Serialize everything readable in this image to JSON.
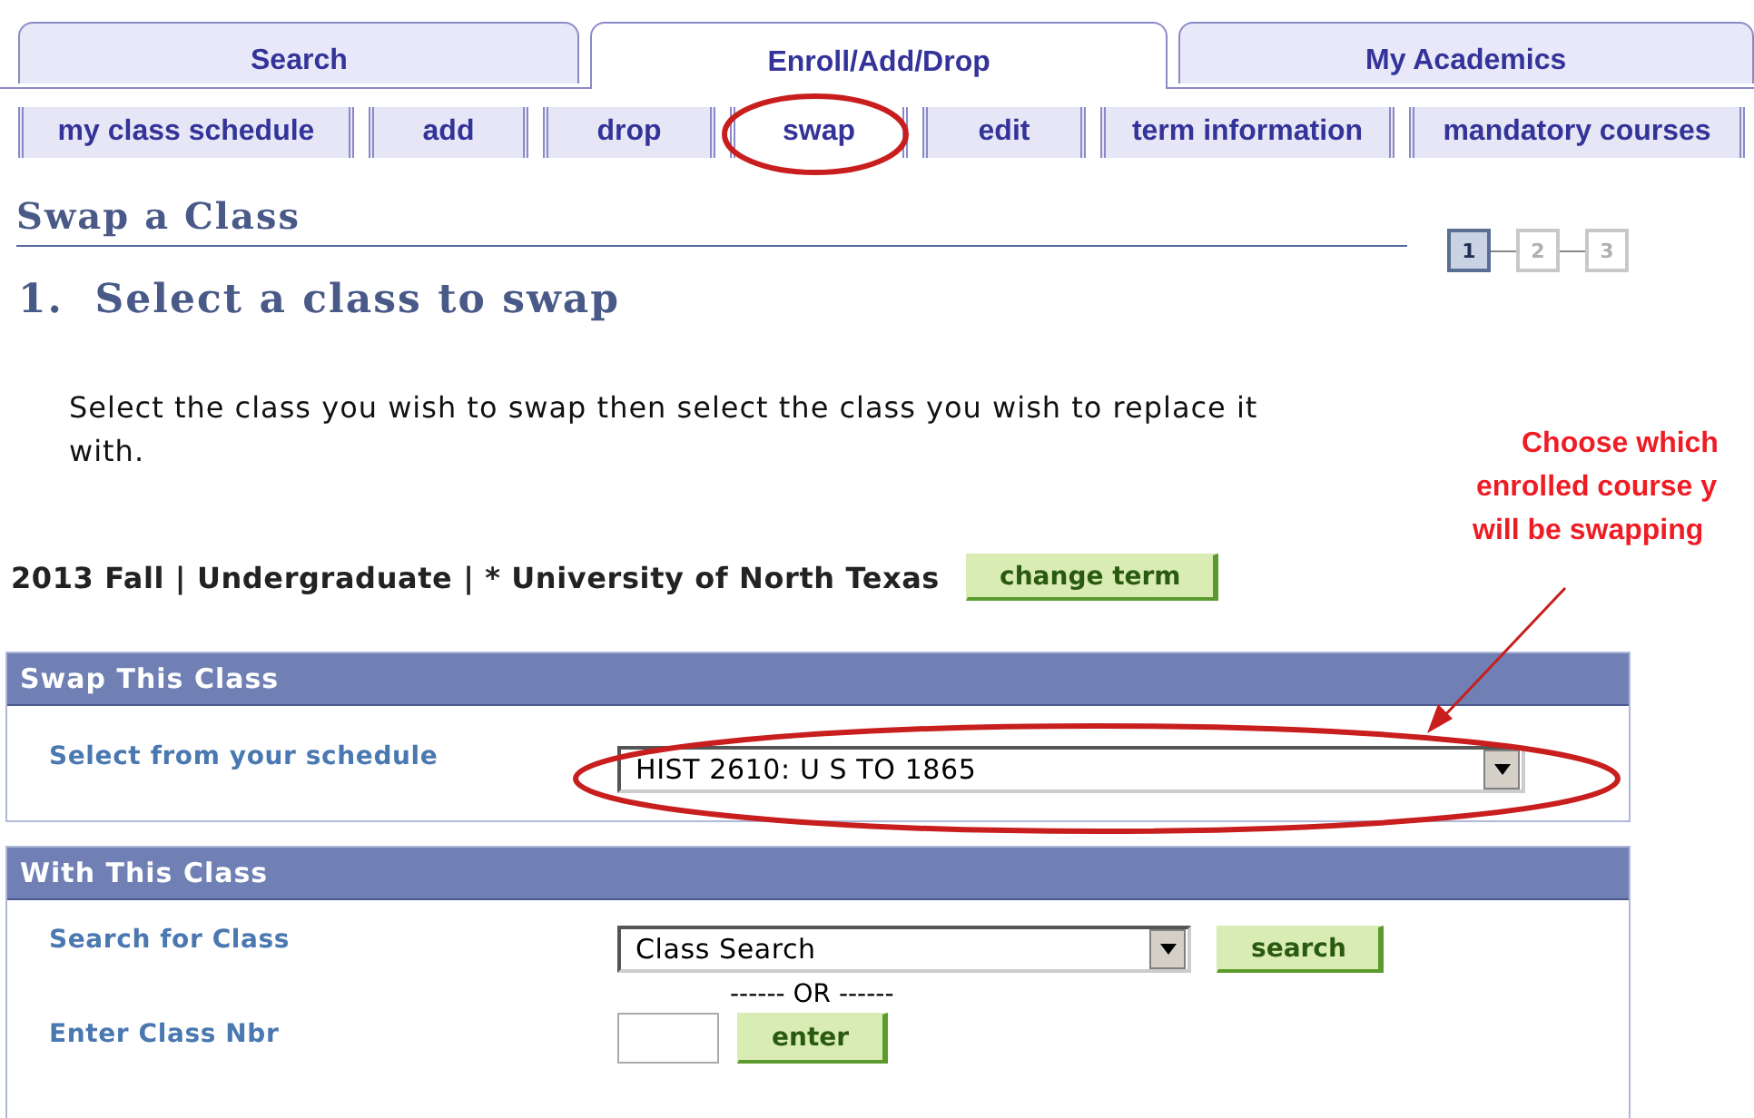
{
  "tabs": [
    {
      "label": "Search",
      "selected": false
    },
    {
      "label": "Enroll/Add/Drop",
      "selected": true
    },
    {
      "label": "My Academics",
      "selected": false
    }
  ],
  "subtabs": [
    {
      "label": "my class schedule",
      "selected": false
    },
    {
      "label": "add",
      "selected": false
    },
    {
      "label": "drop",
      "selected": false
    },
    {
      "label": "swap",
      "selected": true
    },
    {
      "label": "edit",
      "selected": false
    },
    {
      "label": "term information",
      "selected": false
    },
    {
      "label": "mandatory courses",
      "selected": false
    }
  ],
  "page_title": "Swap a Class",
  "steps": [
    {
      "label": "1",
      "selected": true
    },
    {
      "label": "2",
      "selected": false
    },
    {
      "label": "3",
      "selected": false
    }
  ],
  "heading": "1.  Select a class to swap",
  "instructions": "Select the class you wish to swap then select the class you wish to replace it with.",
  "term": {
    "text": "2013 Fall | Undergraduate | * University of North Texas",
    "button": "change term"
  },
  "swap_panel": {
    "title": "Swap This Class",
    "field_label": "Select from your schedule",
    "value": "HIST 2610: U S TO 1865"
  },
  "with_panel": {
    "title": "With This Class",
    "search_label": "Search for Class",
    "search_value": "Class Search",
    "search_button": "search",
    "or_text": "------ OR ------",
    "nbr_label": "Enter Class Nbr",
    "enter_button": "enter"
  },
  "annotation": {
    "callout_lines": [
      "Choose which",
      "enrolled course y",
      "will be swapping"
    ]
  }
}
